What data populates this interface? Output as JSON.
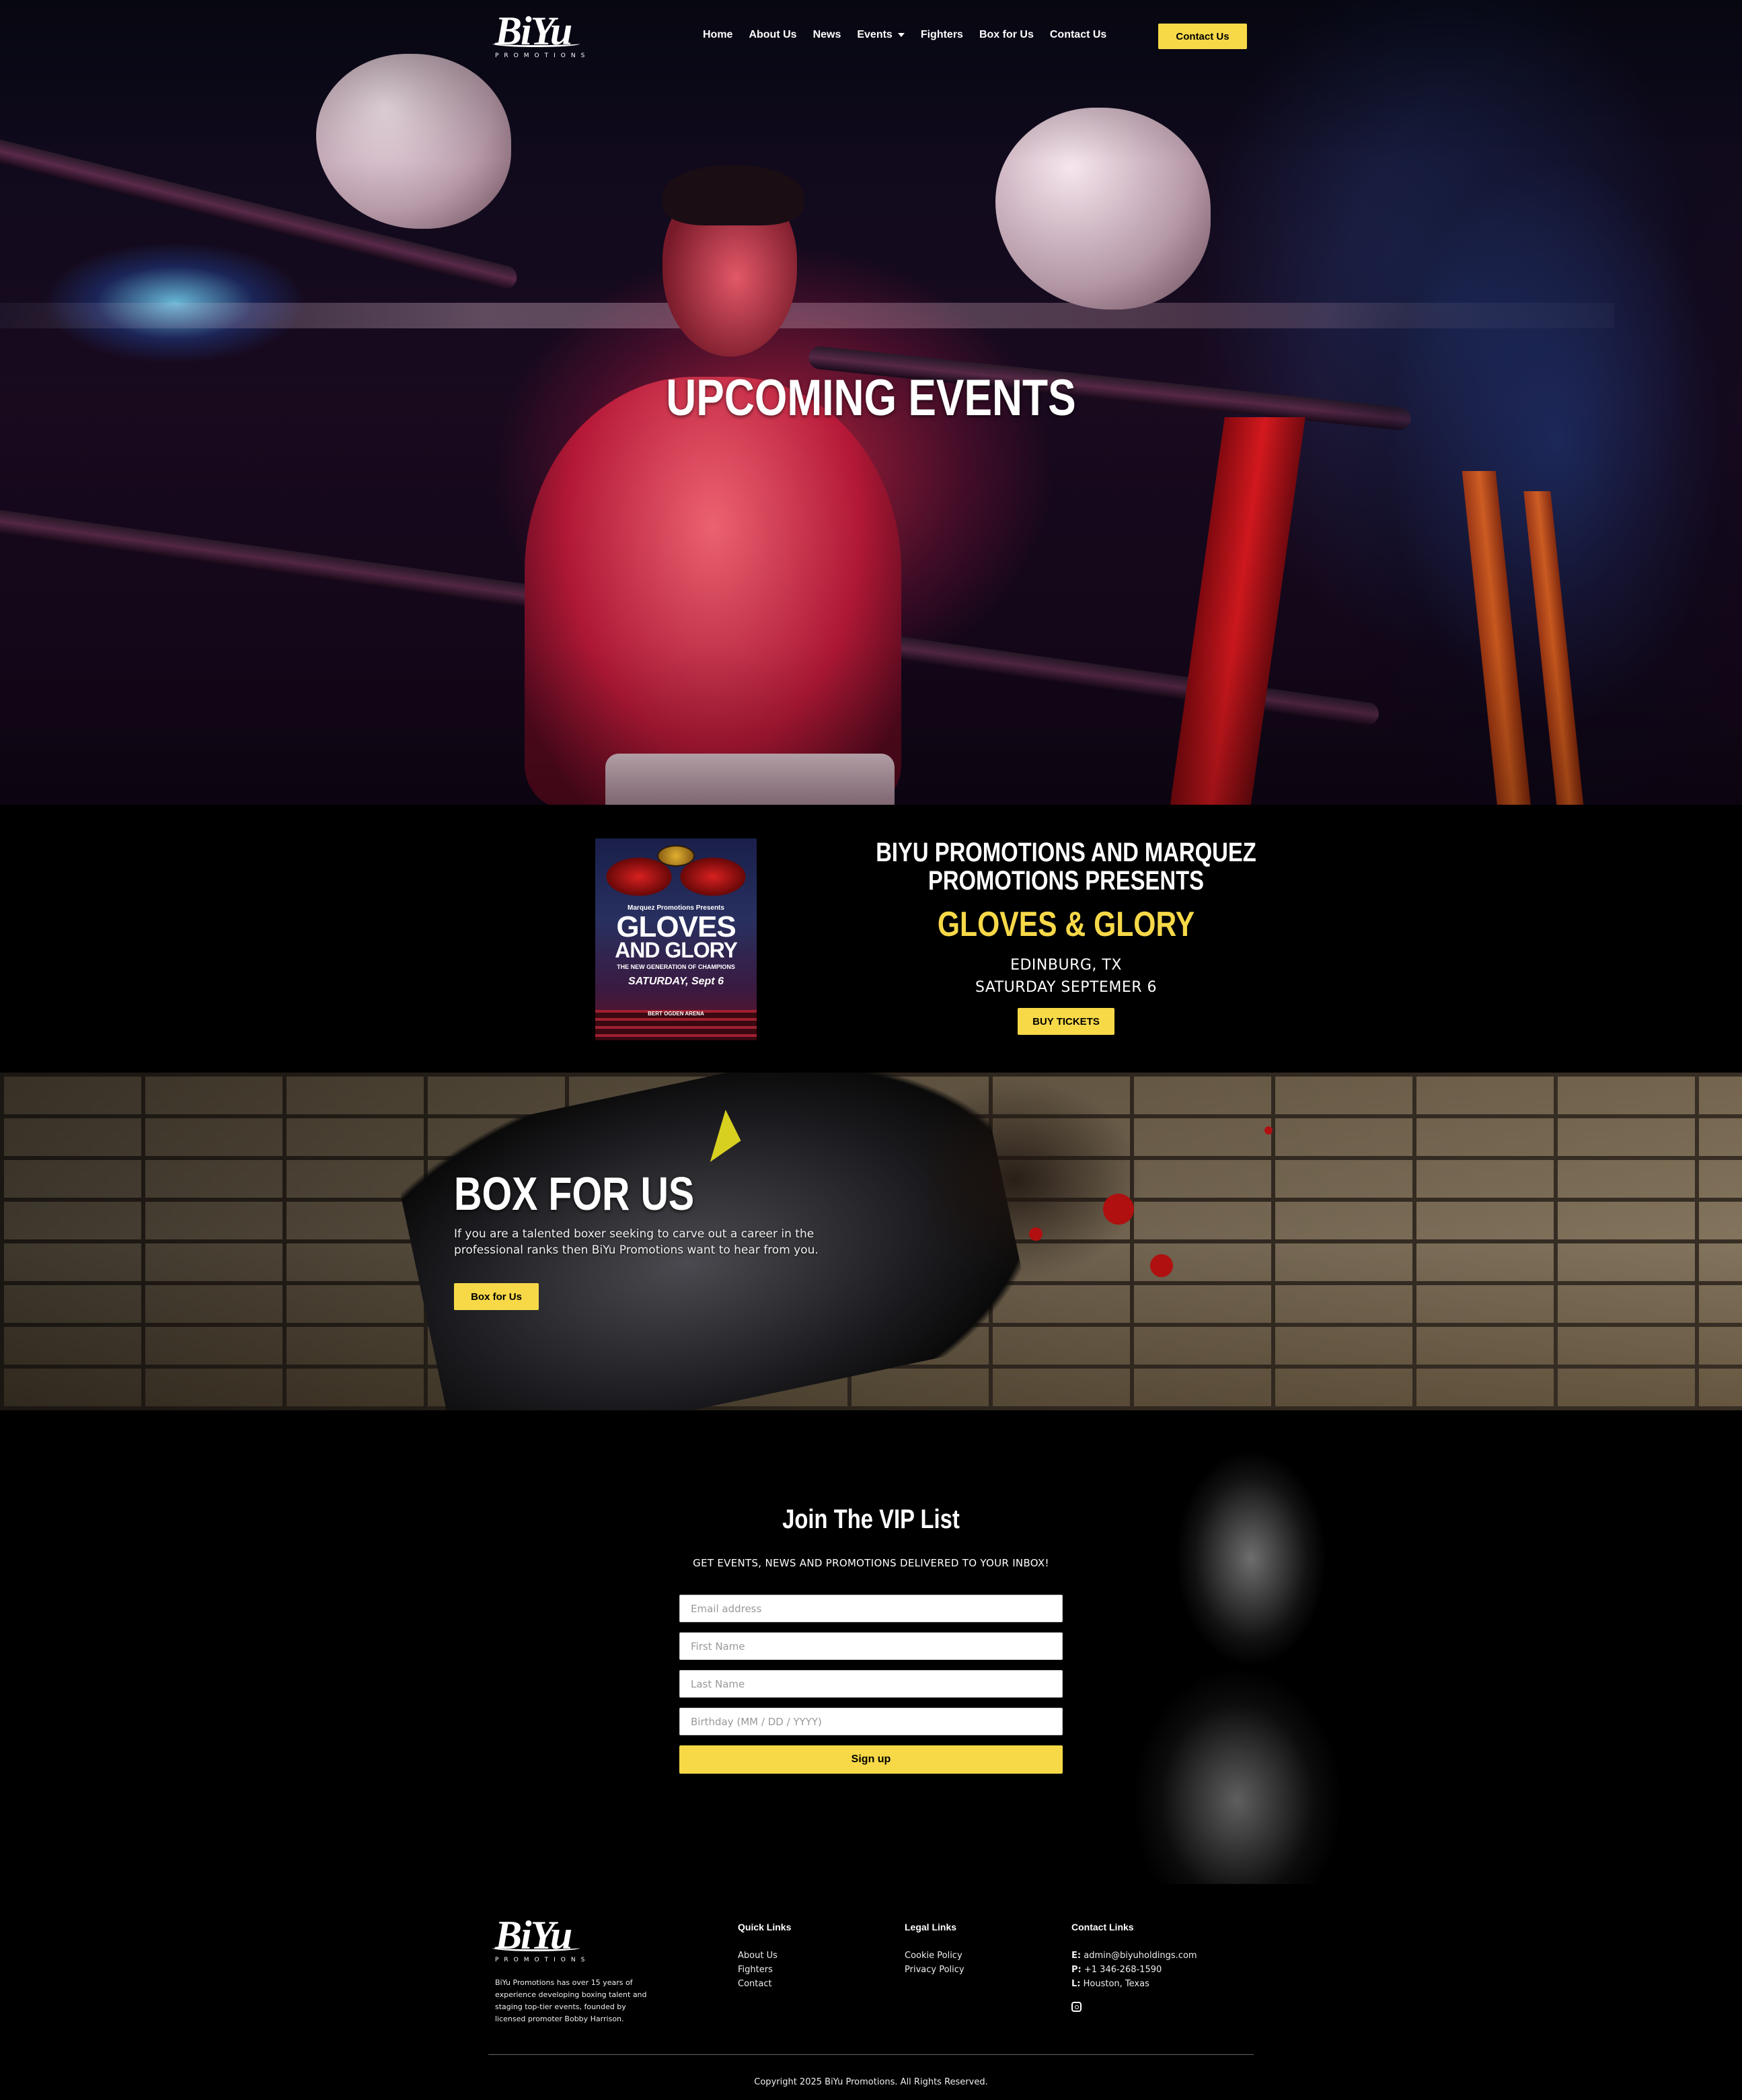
{
  "brand": {
    "name": "BiYu",
    "tagline": "PROMOTIONS"
  },
  "nav": {
    "links": [
      "Home",
      "About Us",
      "News",
      "Events",
      "Fighters",
      "Box for Us",
      "Contact Us"
    ],
    "cta": "Contact Us"
  },
  "hero": {
    "title": "UPCOMING EVENTS"
  },
  "event": {
    "poster": {
      "presenter": "Marquez Promotions Presents",
      "title_line1": "GLOVES",
      "title_line2": "AND GLORY",
      "tagline": "THE NEW GENERATION OF CHAMPIONS",
      "date": "SATURDAY, Sept 6",
      "venue": "BERT OGDEN ARENA"
    },
    "presents": "BIYU PROMOTIONS AND MARQUEZ PROMOTIONS PRESENTS",
    "name": "GLOVES & GLORY",
    "location": "EDINBURG, TX",
    "date": "SATURDAY SEPTEMER 6",
    "button": "BUY TICKETS"
  },
  "box_for_us": {
    "title": "BOX FOR US",
    "text": "If you are a talented boxer seeking to carve out a career in the professional ranks then BiYu Promotions want to hear from you.",
    "button": "Box for Us"
  },
  "vip": {
    "title": "Join The VIP List",
    "subtitle": "GET EVENTS, NEWS AND PROMOTIONS DELIVERED TO YOUR INBOX!",
    "placeholders": [
      "Email address",
      "First Name",
      "Last Name",
      "Birthday (MM / DD / YYYY)"
    ],
    "button": "Sign up"
  },
  "footer": {
    "about": "BiYu Promotions has over 15 years of experience developing boxing talent and staging top-tier events, founded by licensed promoter Bobby Harrison.",
    "quick_links": {
      "title": "Quick Links",
      "items": [
        "About Us",
        "Fighters",
        "Contact"
      ]
    },
    "legal_links": {
      "title": "Legal Links",
      "items": [
        "Cookie Policy",
        "Privacy Policy"
      ]
    },
    "contact": {
      "title": "Contact Links",
      "email_label": "E:",
      "email": "admin@biyuholdings.com",
      "phone_label": "P:",
      "phone": "+1 346-268-1590",
      "location_label": "L:",
      "location": "Houston, Texas",
      "social_icon": "instagram-icon"
    },
    "copyright": "Copyright 2025 BiYu Promotions. All Rights Reserved."
  },
  "colors": {
    "accent": "#f7d948",
    "background": "#000000",
    "text": "#ffffff"
  }
}
